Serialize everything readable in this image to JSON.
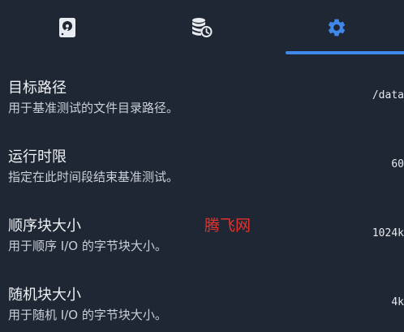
{
  "tabs": [
    {
      "icon": "disk-icon",
      "active": false
    },
    {
      "icon": "database-clock-icon",
      "active": false
    },
    {
      "icon": "gear-icon",
      "active": true
    }
  ],
  "colors": {
    "background": "#1f2734",
    "accent": "#3f87e8",
    "icon_inactive": "#e8ebf0",
    "watermark": "#e0332f"
  },
  "settings": [
    {
      "title": "目标路径",
      "description": "用于基准测试的文件目录路径。",
      "value": "/data"
    },
    {
      "title": "运行时限",
      "description": "指定在此时间段结束基准测试。",
      "value": "60"
    },
    {
      "title": "顺序块大小",
      "description": "用于顺序 I/O 的字节块大小。",
      "value": "1024k"
    },
    {
      "title": "随机块大小",
      "description": "用于随机 I/O 的字节块大小。",
      "value": "4k"
    }
  ],
  "watermark": "腾飞网"
}
